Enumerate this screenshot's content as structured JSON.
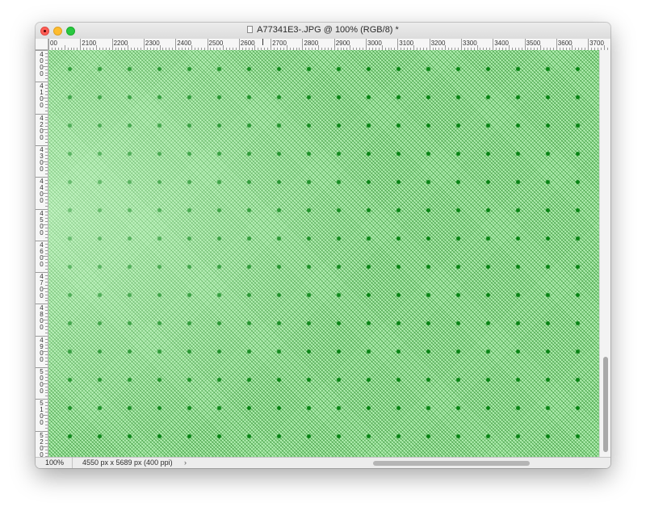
{
  "window": {
    "title": "A77341E3-.JPG @ 100% (RGB/8) *"
  },
  "rulers": {
    "horizontal_labels": [
      "00",
      "2100",
      "2200",
      "2300",
      "2400",
      "2500",
      "2600",
      "2700",
      "2800",
      "2900",
      "3000",
      "3100",
      "3200",
      "3300",
      "3400",
      "3500",
      "3600",
      "3700"
    ],
    "vertical_labels": [
      "4\n0\n0\n0",
      "4\n1\n0\n0",
      "4\n2\n0\n0",
      "4\n3\n0\n0",
      "4\n4\n0\n0",
      "4\n5\n0\n0",
      "4\n6\n0\n0",
      "4\n7\n0\n0",
      "4\n8\n0\n0",
      "4\n9\n0\n0",
      "5\n0\n0\n0",
      "5\n1\n0\n0",
      "5\n2\n0\n0"
    ]
  },
  "canvas": {
    "fill_color": "#b3f0b3",
    "dot_color": "#0a8a1a",
    "hatch_color": "#006e00"
  },
  "statusbar": {
    "zoom": "100%",
    "doc_info": "4550 px x 5689 px (400 ppi)",
    "chevron": "›"
  },
  "scrollbars": {
    "vertical_position": 0.76,
    "horizontal_position": 0.6
  }
}
